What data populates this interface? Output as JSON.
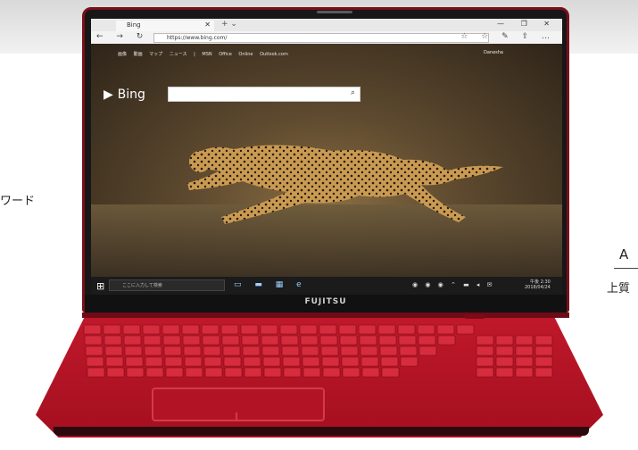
{
  "left_fragment": "ワード",
  "right_fragments": [
    "A",
    "上質"
  ],
  "browser": {
    "tab_title": "Bing",
    "tab_close": "✕",
    "tab_new": "+ ⌄",
    "window_controls": "— ❐ ✕",
    "nav_buttons": "← → ↻",
    "url": "https://www.bing.com/",
    "tool_icons": "☆ ☆ ✎ ⇪ …"
  },
  "bing": {
    "logo": "Bing",
    "top_nav": "画像 動画 マップ ニュース | MSN Office Online Outlook.com",
    "signin": "Danesha"
  },
  "taskbar": {
    "start_glyph": "⊞",
    "search_placeholder": "ここに入力して検索",
    "task_icons": "▭ ▬ ▦ e",
    "tray": "◉ ◉ ◉ ⌃ ▬ ◂ ✉",
    "clock_time": "午後 2:30",
    "clock_date": "2018/04/24"
  },
  "brand": "FUJITSU",
  "colors": {
    "body_red": "#c0192b",
    "screen_bezel": "#171717"
  }
}
